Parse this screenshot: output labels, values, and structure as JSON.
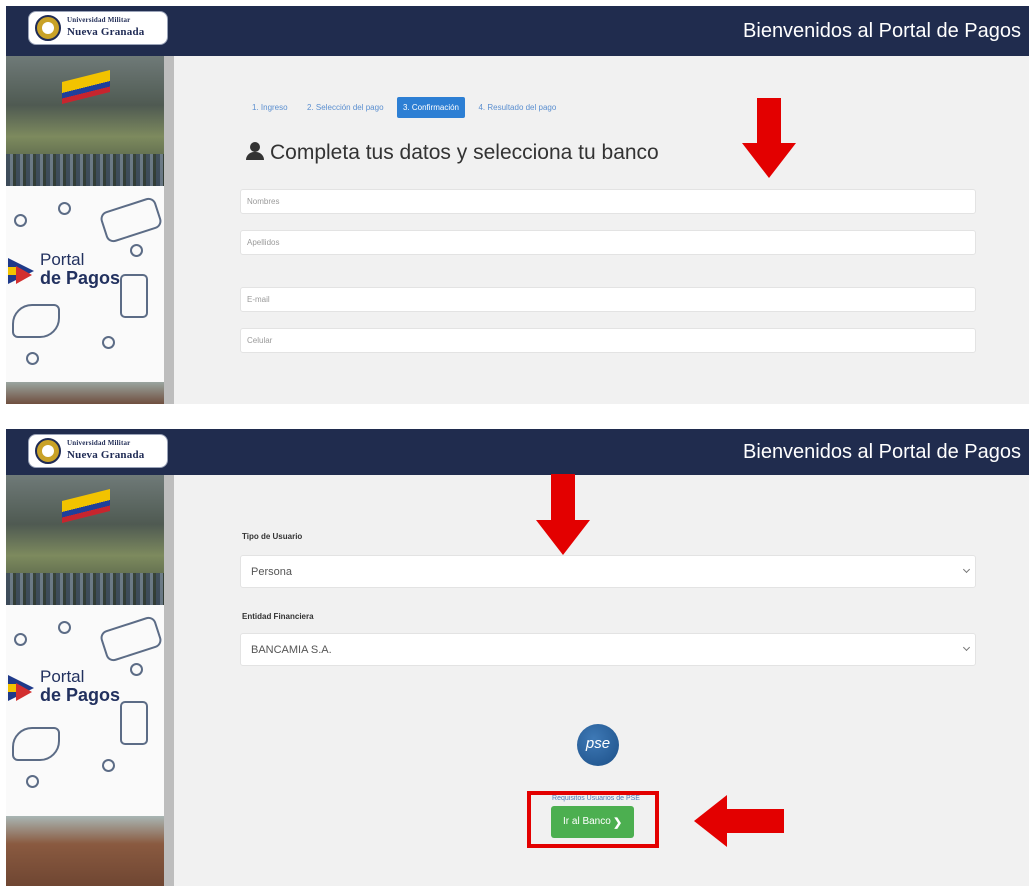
{
  "header": {
    "logo_line1": "Universidad Militar",
    "logo_line2": "Nueva Granada",
    "title": "Bienvenidos al Portal de Pagos"
  },
  "sidebar": {
    "brand_line1": "Portal",
    "brand_line2": "de Pagos"
  },
  "steps": [
    {
      "label": "1. Ingreso"
    },
    {
      "label": "2. Selección del pago"
    },
    {
      "label": "3. Confirmación",
      "active": true
    },
    {
      "label": "4. Resultado del pago"
    }
  ],
  "form": {
    "title": "Completa tus datos y selecciona tu banco",
    "nombres_placeholder": "Nombres",
    "apellidos_placeholder": "Apellidos",
    "email_placeholder": "E-mail",
    "celular_placeholder": "Celular"
  },
  "bank": {
    "tipo_usuario_label": "Tipo de Usuario",
    "tipo_usuario_value": "Persona",
    "entidad_label": "Entidad Financiera",
    "entidad_value": "BANCAMIA S.A.",
    "pse_logo_text": "pse",
    "pse_caption": "Requisitos Usuarios de PSE",
    "submit_label": "Ir al Banco"
  },
  "colors": {
    "header_bg": "#202c4e",
    "active_step": "#2d7fd4",
    "submit_button": "#4caf50",
    "highlight": "#e30000"
  }
}
